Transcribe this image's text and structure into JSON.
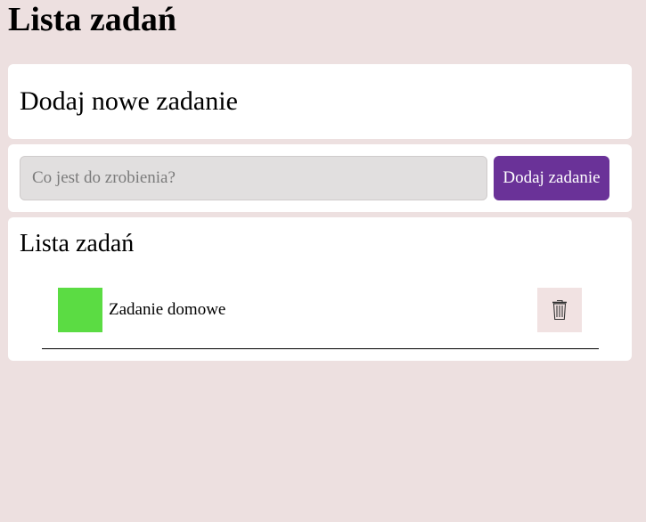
{
  "page": {
    "title": "Lista zadań"
  },
  "add_section": {
    "heading": "Dodaj nowe zadanie"
  },
  "form": {
    "input_placeholder": "Co jest do zrobienia?",
    "input_value": "",
    "add_button_label": "Dodaj zadanie"
  },
  "list_section": {
    "title": "Lista zadań",
    "items": [
      {
        "label": "Zadanie domowe",
        "checkbox_color": "#5bdc43",
        "delete_icon": "trash-icon"
      }
    ]
  },
  "colors": {
    "background": "#ede0e0",
    "accent": "#6a3298",
    "card": "#ffffff"
  }
}
